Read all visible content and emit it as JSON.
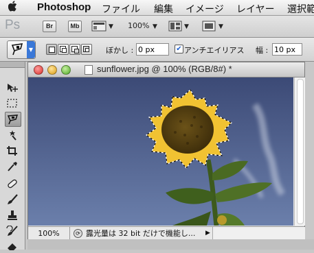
{
  "menubar": {
    "apple": "",
    "app_name": "Photoshop",
    "items": [
      "ファイル",
      "編集",
      "イメージ",
      "レイヤー",
      "選択範"
    ]
  },
  "appbar": {
    "logo": "Ps",
    "bridge_label": "Br",
    "minibridge_label": "Mb",
    "zoom": "100%"
  },
  "options": {
    "feather_label": "ぼかし :",
    "feather_value": "0 px",
    "antialias_checked": true,
    "antialias_label": "アンチエイリアス",
    "width_label": "幅 :",
    "width_value": "10 px"
  },
  "tools": [
    "move-tool",
    "marquee-tool",
    "magnetic-lasso-tool",
    "quick-selection-tool",
    "crop-tool",
    "eyedropper-tool",
    "healing-brush-tool",
    "brush-tool",
    "clone-stamp-tool",
    "history-brush-tool",
    "eraser-tool"
  ],
  "document": {
    "title": "sunflower.jpg @ 100% (RGB/8#) *",
    "status_zoom": "100%",
    "status_text": "露光量は 32 bit だけで機能し..."
  },
  "colors": {
    "sky_top": "#3f4d78",
    "sky_bottom": "#667aa6",
    "petal": "#f1c232",
    "disc": "#5a4312",
    "stem": "#3d5a1c",
    "active_blue": "#3a78d8"
  }
}
